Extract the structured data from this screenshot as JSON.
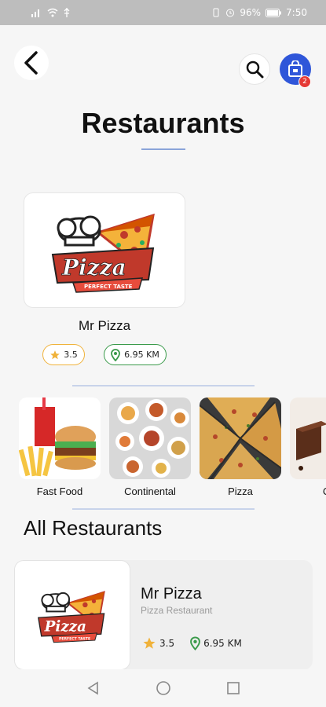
{
  "status_bar": {
    "battery": "96%",
    "time": "7:50"
  },
  "header": {
    "title": "Restaurants",
    "cart_count": "2",
    "icons": [
      "back-arrow-icon",
      "search-icon",
      "shopping-bag-icon"
    ]
  },
  "featured": {
    "name": "Mr Pizza",
    "rating": "3.5",
    "distance": "6.95 KM",
    "logo_text": "Pizza",
    "logo_tagline": "PERFECT TASTE"
  },
  "categories": [
    {
      "label": "Fast Food"
    },
    {
      "label": "Continental"
    },
    {
      "label": "Pizza"
    },
    {
      "label": "Caf"
    }
  ],
  "section": {
    "title": "All Restaurants"
  },
  "restaurants": [
    {
      "name": "Mr Pizza",
      "type": "Pizza Restaurant",
      "rating": "3.5",
      "distance": "6.95 KM"
    }
  ],
  "colors": {
    "accent": "#2f56d9",
    "badge": "#e53935",
    "star": "#f0b23a",
    "location": "#3a9a4a"
  }
}
